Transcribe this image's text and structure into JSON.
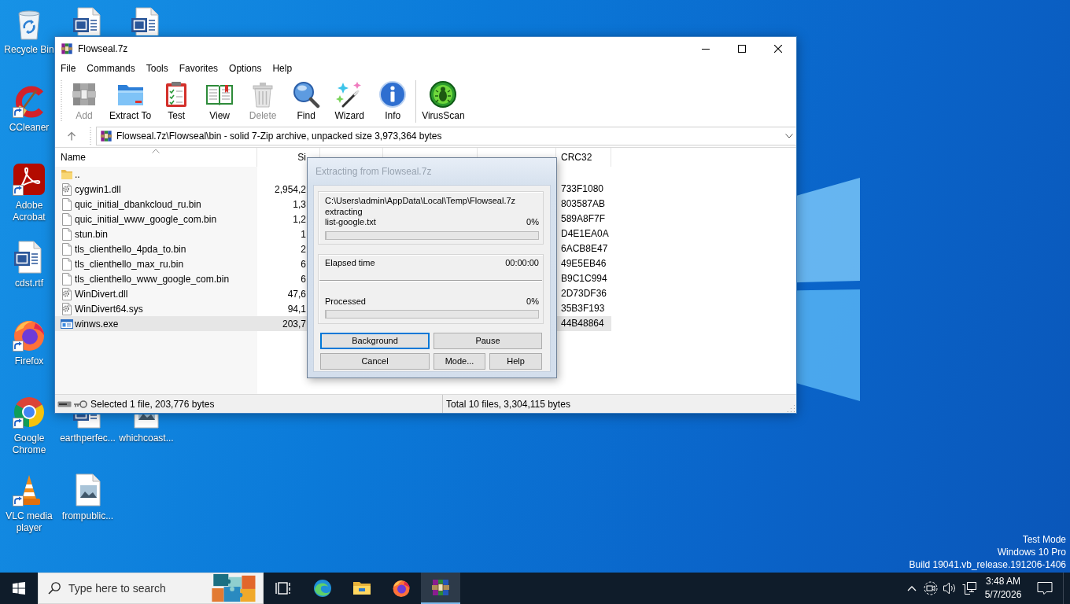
{
  "desktop": {
    "icons": [
      {
        "kind": "recycle",
        "label": "Recycle Bin",
        "shortcut": false
      },
      {
        "kind": "word",
        "shortcut": false
      },
      {
        "kind": "word",
        "shortcut": false
      },
      {
        "kind": "ccleaner",
        "label": "CCleaner",
        "shortcut": true
      },
      {
        "kind": "acrobat",
        "label": "Adobe Acrobat",
        "shortcut": true
      },
      {
        "kind": "word",
        "label": "cdst.rtf",
        "shortcut": false
      },
      {
        "kind": "firefox",
        "label": "Firefox",
        "shortcut": true
      },
      {
        "kind": "chrome",
        "label": "Google Chrome",
        "shortcut": true
      },
      {
        "kind": "word",
        "label": "earthperfec...",
        "shortcut": false
      },
      {
        "kind": "image",
        "label": "whichcoast...",
        "shortcut": false
      },
      {
        "kind": "vlc",
        "label": "VLC media player",
        "shortcut": true
      },
      {
        "kind": "image",
        "label": "frompublic...",
        "shortcut": false
      }
    ],
    "system_info": [
      "Test Mode",
      "Windows 10 Pro",
      "Build 19041.vb_release.191206-1406"
    ]
  },
  "window": {
    "title": "Flowseal.7z",
    "menu": [
      "File",
      "Commands",
      "Tools",
      "Favorites",
      "Options",
      "Help"
    ],
    "toolbar": [
      {
        "kind": "add",
        "label": "Add",
        "disabled": true
      },
      {
        "kind": "extract",
        "label": "Extract To",
        "disabled": false
      },
      {
        "kind": "test",
        "label": "Test",
        "disabled": false
      },
      {
        "kind": "view",
        "label": "View",
        "disabled": false
      },
      {
        "kind": "delete",
        "label": "Delete",
        "disabled": true
      },
      {
        "kind": "find",
        "label": "Find",
        "disabled": false
      },
      {
        "kind": "wizard",
        "label": "Wizard",
        "disabled": false
      },
      {
        "kind": "info",
        "label": "Info",
        "disabled": false
      },
      {
        "kind": "virusscan",
        "label": "VirusScan",
        "disabled": false
      }
    ],
    "address": {
      "value": "Flowseal.7z\\Flowseal\\bin - solid 7-Zip archive, unpacked size 3,973,364 bytes"
    },
    "file_list": {
      "columns": [
        {
          "label": "Name",
          "sorted": true
        },
        {
          "label": "Si",
          "sorted": false
        },
        {
          "label": "CRC32",
          "sorted": false
        }
      ],
      "rows": [
        {
          "kind": "folder",
          "name": "..",
          "selected": false
        },
        {
          "kind": "system",
          "name": "cygwin1.dll",
          "size": "2,954,2",
          "crc": "733F1080",
          "selected": false
        },
        {
          "kind": "file",
          "name": "quic_initial_dbankcloud_ru.bin",
          "size": "1,3",
          "crc": "803587AB",
          "selected": false
        },
        {
          "kind": "file",
          "name": "quic_initial_www_google_com.bin",
          "size": "1,2",
          "crc": "589A8F7F",
          "selected": false
        },
        {
          "kind": "file",
          "name": "stun.bin",
          "size": "1",
          "crc": "D4E1EA0A",
          "selected": false
        },
        {
          "kind": "file",
          "name": "tls_clienthello_4pda_to.bin",
          "size": "2",
          "crc": "6ACB8E47",
          "selected": false
        },
        {
          "kind": "file",
          "name": "tls_clienthello_max_ru.bin",
          "size": "6",
          "crc": "49E5EB46",
          "selected": false
        },
        {
          "kind": "file",
          "name": "tls_clienthello_www_google_com.bin",
          "size": "6",
          "crc": "B9C1C994",
          "selected": false
        },
        {
          "kind": "system",
          "name": "WinDivert.dll",
          "size": "47,6",
          "crc": "2D73DF36",
          "selected": false
        },
        {
          "kind": "system",
          "name": "WinDivert64.sys",
          "size": "94,1",
          "crc": "35B3F193",
          "selected": false
        },
        {
          "kind": "exe",
          "name": "winws.exe",
          "size": "203,7",
          "crc": "44B48864",
          "selected": true
        }
      ]
    },
    "status_bar": {
      "selection": "Selected 1 file, 203,776 bytes",
      "total": "Total 10 files, 3,304,115 bytes"
    }
  },
  "dialog": {
    "title": "Extracting from Flowseal.7z",
    "active": false,
    "archive_path": "C:\\Users\\admin\\AppData\\Local\\Temp\\Flowseal.7z",
    "action": "extracting",
    "current_file": "list-google.txt",
    "file_percent": "0%",
    "file_progress": {
      "level": 0
    },
    "elapsed_label": "Elapsed time",
    "elapsed_value": "00:00:00",
    "processed_label": "Processed",
    "processed_percent": "0%",
    "processed_progress": {
      "level": 0
    },
    "buttons": [
      {
        "label": "Background",
        "focused": true
      },
      {
        "label": "Pause",
        "focused": false
      },
      {
        "label": "Cancel",
        "focused": false
      },
      {
        "label": "Mode...",
        "focused": false
      },
      {
        "label": "Help",
        "focused": false
      }
    ]
  },
  "taskbar": {
    "search": {
      "placeholder": "Type here to search"
    },
    "apps": [
      {
        "kind": "taskview",
        "active": false
      },
      {
        "kind": "edge",
        "active": false
      },
      {
        "kind": "explorer",
        "active": false
      },
      {
        "kind": "firefox",
        "active": false
      },
      {
        "kind": "winrar",
        "active": true
      }
    ],
    "clock": {
      "time": "3:48 AM",
      "date": "5/7/2026"
    }
  }
}
